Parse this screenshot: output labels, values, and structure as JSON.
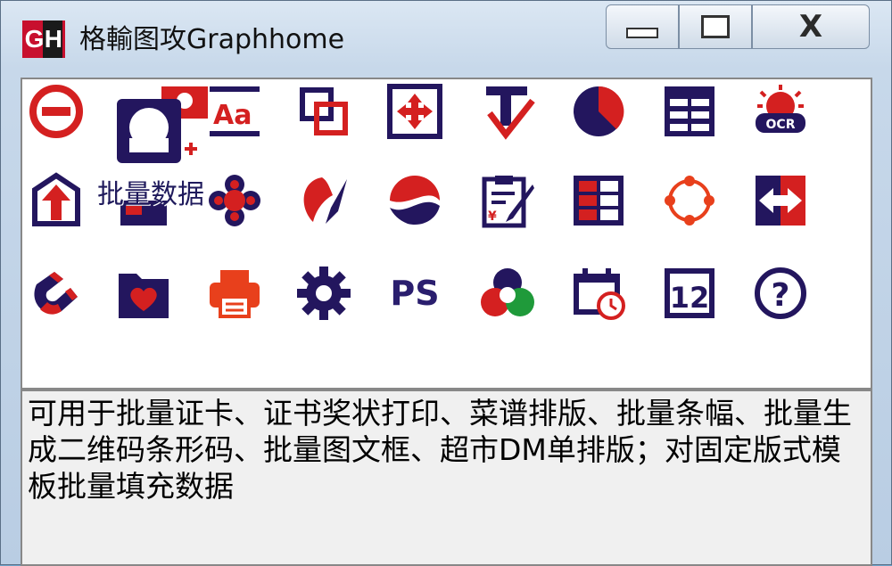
{
  "window": {
    "title": "格輸图攻Graphhome",
    "logo_text_g": "G",
    "logo_text_h": "H",
    "close_glyph": "X"
  },
  "colors": {
    "brand_red": "#d42020",
    "brand_navy": "#23165e",
    "orange": "#e8401c"
  },
  "toolbar": {
    "icons": [
      "no-entry-icon",
      "id-photo-icon",
      "font-icon",
      "layers-icon",
      "move-arrows-icon",
      "text-check-icon",
      "pie-chart-icon",
      "table-icon",
      "ocr-sun-icon",
      "upload-arrow-icon",
      "batch-data-icon",
      "flower-cluster-icon",
      "leaf-pen-icon",
      "wave-logo-icon",
      "clipboard-edit-icon",
      "grid-blocks-icon",
      "ring-dots-icon",
      "swap-arrows-icon",
      "magnet-icon",
      "heart-folder-icon",
      "printer-icon",
      "settings-gear-icon",
      "photoshop-ps-icon",
      "color-circles-icon",
      "calendar-clock-icon",
      "page-number-icon",
      "help-icon"
    ],
    "ps_label": "PS",
    "ocr_label": "OCR",
    "page_label": "12"
  },
  "tooltip": {
    "label": "批量数据"
  },
  "description": {
    "text": "可用于批量证卡、证书奖状打印、菜谱排版、批量条幅、批量生成二维码条形码、批量图文框、超市DM单排版；对固定版式模板批量填充数据"
  }
}
